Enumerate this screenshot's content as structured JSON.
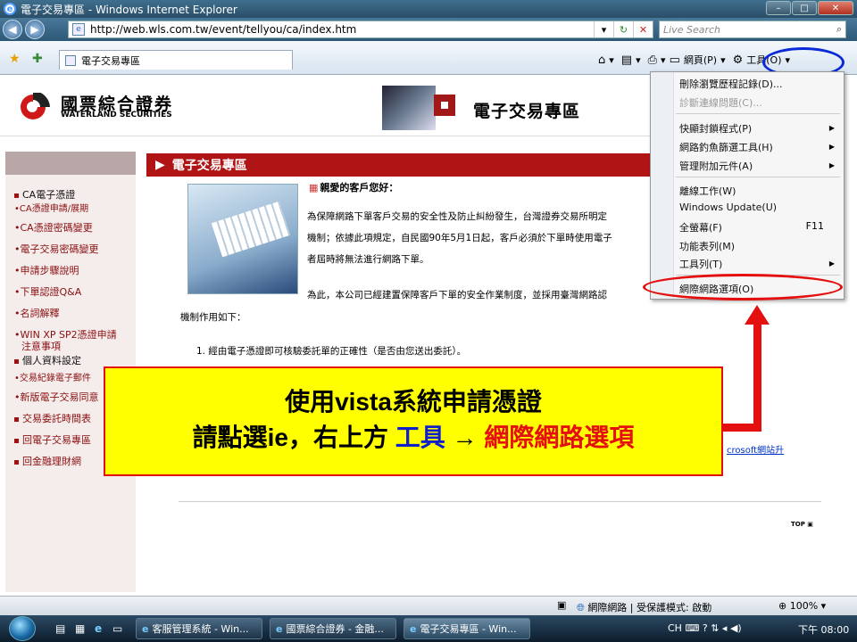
{
  "window": {
    "title": "電子交易專區 - Windows Internet Explorer"
  },
  "address": {
    "url": "http://web.wls.com.tw/event/tellyou/ca/index.htm"
  },
  "search": {
    "placeholder": "Live Search"
  },
  "tab": {
    "label": "電子交易專區"
  },
  "command_bar": {
    "page_label": "網頁(P)",
    "tools_label": "工具(O)"
  },
  "header": {
    "logo_cn": "國票綜合證券",
    "logo_en": "WATERLAND SECURITIES",
    "banner_title": "電子交易專區"
  },
  "sidebar": {
    "items": [
      {
        "label": "CA電子憑證"
      },
      {
        "label": "CA憑證申請/展期"
      },
      {
        "label": "CA憑證密碼變更"
      },
      {
        "label": "電子交易密碼變更"
      },
      {
        "label": "申請步驟說明"
      },
      {
        "label": "下單認證Q&A"
      },
      {
        "label": "名詞解釋"
      },
      {
        "label": "WIN XP SP2憑證申請"
      },
      {
        "label": "注意事項"
      },
      {
        "label": "個人資料設定"
      },
      {
        "label": "交易紀錄電子郵件"
      },
      {
        "label": "新版電子交易同意"
      },
      {
        "label": "交易委託時間表"
      },
      {
        "label": "回電子交易專區"
      },
      {
        "label": "回金融理財網"
      }
    ]
  },
  "content": {
    "section_title": "電子交易專區",
    "greeting": "親愛的客戶您好：",
    "para1_line1": "為保障網路下單客戶交易的安全性及防止糾紛發生，台灣證券交易所明定",
    "para1_line2": "機制；依據此項規定，自民國90年5月1日起，客戶必須於下單時使用電子",
    "para1_line3": "者屆時將無法進行網路下單。",
    "para2_line1": "為此，本公司已經建置保障客戶下單的安全作業制度，並採用臺灣網路認",
    "para2_line2": "機制作用如下：",
    "item1": "1.  經由電子憑證即可核驗委託單的正確性（是否由您送出委託）。",
    "ms_text": "crosoft網站升",
    "top_label": "TOP"
  },
  "tools_menu": {
    "items": [
      {
        "label": "刪除瀏覽歷程記錄(D)...",
        "disabled": false
      },
      {
        "label": "診斷連線問題(C)...",
        "disabled": true
      },
      {
        "label": "快顯封鎖程式(P)",
        "submenu": true
      },
      {
        "label": "網路釣魚篩選工具(H)",
        "submenu": true
      },
      {
        "label": "管理附加元件(A)",
        "submenu": true
      },
      {
        "label": "離線工作(W)"
      },
      {
        "label": "Windows Update(U)"
      },
      {
        "label": "全螢幕(F)",
        "shortcut": "F11"
      },
      {
        "label": "功能表列(M)"
      },
      {
        "label": "工具列(T)",
        "submenu": true
      },
      {
        "label": "網際網路選項(O)"
      }
    ]
  },
  "callout": {
    "line1": "使用vista系統申請憑證",
    "line2_prefix": "請點選ie，右上方 ",
    "line2_tools": "工具",
    "line2_arrow": " → ",
    "line2_option": "網際網路選項"
  },
  "status": {
    "zone": "網際網路 | 受保護模式: 啟動",
    "zoom": "100%"
  },
  "taskbar": {
    "tasks": [
      {
        "label": "客服管理系統 - Win..."
      },
      {
        "label": "國票綜合證券 - 金融..."
      },
      {
        "label": "電子交易專區 - Win..."
      }
    ],
    "tray_lang": "CH",
    "clock": "下午 08:00"
  },
  "colors": {
    "accent_red": "#e41010",
    "callout_bg": "#ffff00",
    "tools_blue": "#0a2ad8",
    "section_red": "#b11414"
  }
}
